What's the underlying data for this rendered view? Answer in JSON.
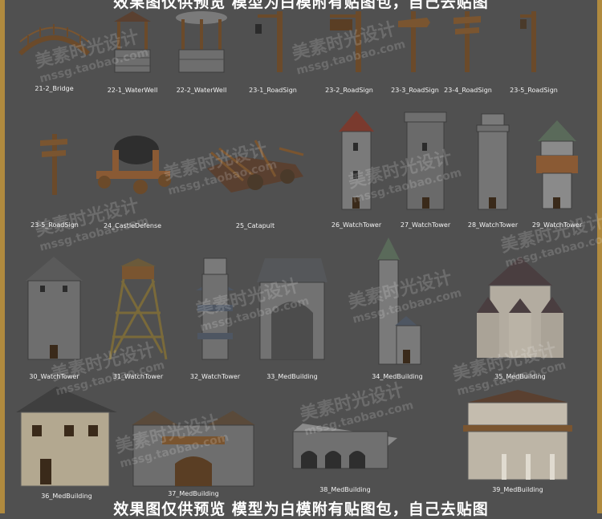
{
  "banner_top": "效果图仅供预览 模型为白模附有贴图包，自己去贴图",
  "banner_bottom": "效果图仅供预览 模型为白模附有贴图包，自己去贴图",
  "watermark": {
    "text": "美素时光设计",
    "url": "mssg.taobao.com"
  },
  "colors": {
    "background": "#505050",
    "border": "#b08a3e",
    "caption": "#f2f2f2"
  },
  "models": [
    {
      "label": "21-2_Bridge",
      "icon": "bridge-model"
    },
    {
      "label": "22-1_WaterWell",
      "icon": "water-well-model"
    },
    {
      "label": "22-2_WaterWell",
      "icon": "water-well-model"
    },
    {
      "label": "23-1_RoadSign",
      "icon": "road-sign-model"
    },
    {
      "label": "23-2_RoadSign",
      "icon": "road-sign-model"
    },
    {
      "label": "23-3_RoadSign",
      "icon": "road-sign-model"
    },
    {
      "label": "23-4_RoadSign",
      "icon": "road-sign-model"
    },
    {
      "label": "23-5_RoadSign",
      "icon": "road-sign-model"
    },
    {
      "label": "23-5_RoadSign",
      "icon": "road-sign-model"
    },
    {
      "label": "24_CastleDefense",
      "icon": "castle-defense-model"
    },
    {
      "label": "25_Catapult",
      "icon": "catapult-model"
    },
    {
      "label": "26_WatchTower",
      "icon": "watch-tower-model"
    },
    {
      "label": "27_WatchTower",
      "icon": "watch-tower-model"
    },
    {
      "label": "28_WatchTower",
      "icon": "watch-tower-model"
    },
    {
      "label": "29_WatchTower",
      "icon": "watch-tower-model"
    },
    {
      "label": "30_WatchTower",
      "icon": "watch-tower-model"
    },
    {
      "label": "31_WatchTower",
      "icon": "watch-tower-model"
    },
    {
      "label": "32_WatchTower",
      "icon": "watch-tower-model"
    },
    {
      "label": "33_MedBuilding",
      "icon": "medieval-building-model"
    },
    {
      "label": "34_MedBuilding",
      "icon": "medieval-building-model"
    },
    {
      "label": "35_MedBuilding",
      "icon": "medieval-building-model"
    },
    {
      "label": "36_MedBuilding",
      "icon": "medieval-building-model"
    },
    {
      "label": "37_MedBuilding",
      "icon": "medieval-building-model"
    },
    {
      "label": "38_MedBuilding",
      "icon": "medieval-building-model"
    },
    {
      "label": "39_MedBuilding",
      "icon": "medieval-building-model"
    }
  ]
}
